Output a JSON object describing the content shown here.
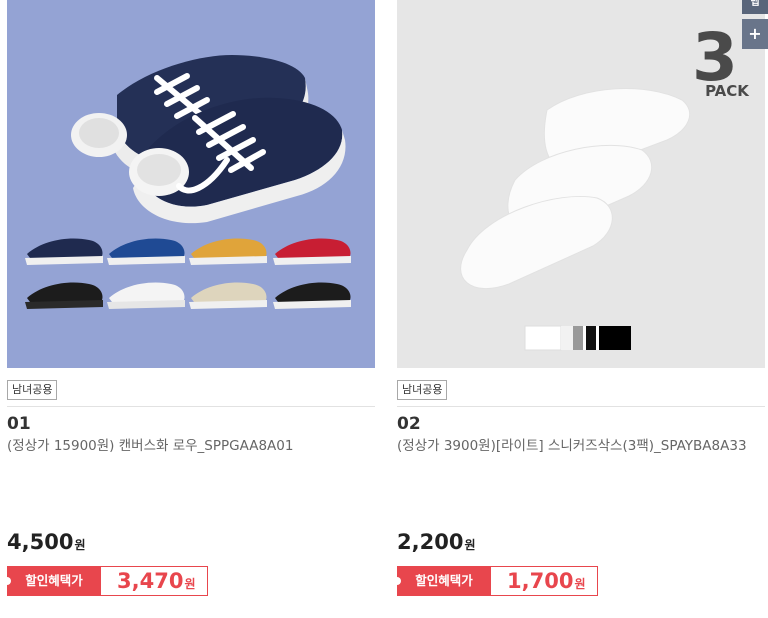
{
  "products": [
    {
      "badge": "남녀공용",
      "number": "01",
      "name": "(정상가 15900원) 캔버스화 로우_SPPGAA8A01",
      "price": "4,500",
      "currency": "원",
      "benefit_label": "할인혜택가",
      "benefit_price": "3,470",
      "image_bg": "#94a3d4"
    },
    {
      "badge": "남녀공용",
      "number": "02",
      "name": "(정상가 3900원)[라이트] 스니커즈삭스(3팩)_SPAYBA8A33",
      "price": "2,200",
      "currency": "원",
      "benefit_label": "할인혜택가",
      "benefit_price": "1,700",
      "image_bg": "#e6e6e6",
      "pack_number": "3",
      "pack_text": "PACK"
    }
  ],
  "side_buttons": {
    "top_label": "맵",
    "plus_label": "+"
  },
  "colors": {
    "accent_red": "#e8464d",
    "side_button": "#59657a"
  }
}
